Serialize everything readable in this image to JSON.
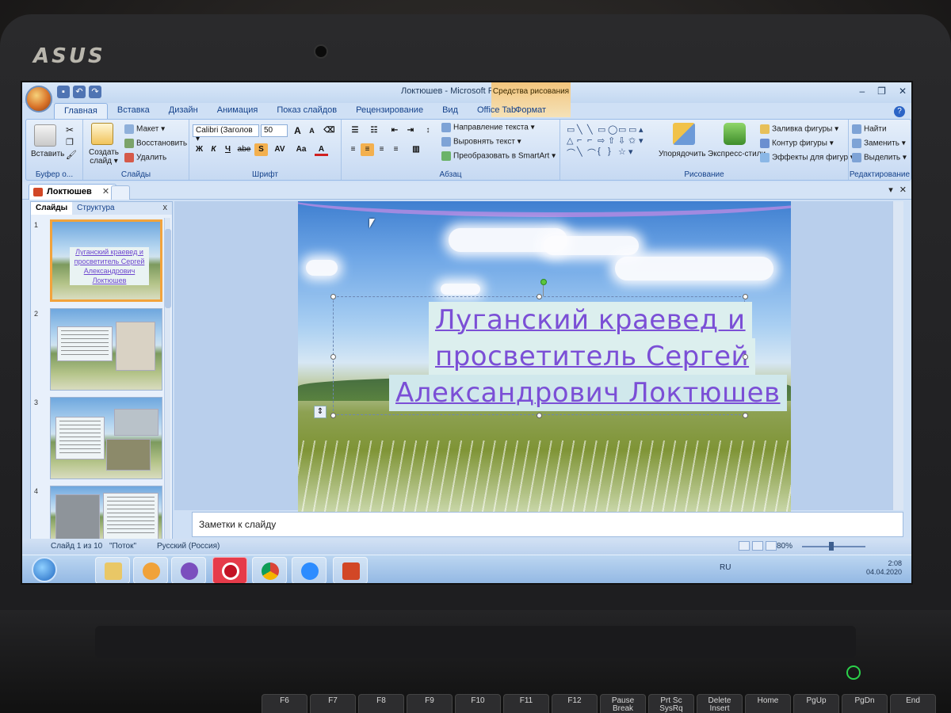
{
  "laptop": {
    "brand": "ASUS"
  },
  "window": {
    "title": "Локтюшев - Microsoft PowerPoint",
    "contextual_group": "Средства рисования",
    "controls": [
      "–",
      "❐",
      "✕"
    ]
  },
  "ribbon_tabs": [
    "Главная",
    "Вставка",
    "Дизайн",
    "Анимация",
    "Показ слайдов",
    "Рецензирование",
    "Вид",
    "Office Tab"
  ],
  "ribbon_tab_format": "Формат",
  "ribbon": {
    "clipboard": {
      "paste": "Вставить",
      "label": "Буфер о..."
    },
    "slides": {
      "new_slide": "Создать слайд ▾",
      "layout": "Макет ▾",
      "reset": "Восстановить",
      "delete": "Удалить",
      "label": "Слайды"
    },
    "font": {
      "font_name": "Calibri (Заголов ▾",
      "font_size": "50",
      "label": "Шрифт",
      "buttons": [
        "Ж",
        "К",
        "Ч",
        "abe",
        "S",
        "AV",
        "Aa",
        "A"
      ]
    },
    "paragraph": {
      "text_direction": "Направление текста ▾",
      "align_text": "Выровнять текст ▾",
      "convert_smartart": "Преобразовать в SmartArt ▾",
      "label": "Абзац"
    },
    "drawing": {
      "arrange": "Упорядочить",
      "quick_styles": "Экспресс-стили",
      "shape_fill": "Заливка фигуры ▾",
      "shape_outline": "Контур фигуры ▾",
      "shape_effects": "Эффекты для фигур ▾",
      "label": "Рисование"
    },
    "editing": {
      "find": "Найти",
      "replace": "Заменить ▾",
      "select": "Выделить ▾",
      "label": "Редактирование"
    }
  },
  "document_tab": {
    "name": "Локтюшев",
    "close": "✕"
  },
  "left_panel": {
    "tabs": [
      "Слайды",
      "Структура"
    ],
    "close": "x",
    "slide_numbers": [
      "1",
      "2",
      "3",
      "4"
    ],
    "thumb1_title": "Луганский краевед и просветитель Сергей Александрович Локтюшев"
  },
  "slide": {
    "title_lines": [
      "Луганский краевед и",
      "просветитель Сергей",
      "Александрович Локтюшев"
    ]
  },
  "notes_placeholder": "Заметки к слайду",
  "status_bar": {
    "slide_info": "Слайд 1 из 10",
    "theme": "\"Поток\"",
    "language": "Русский (Россия)",
    "zoom": "80%"
  },
  "taskbar": {
    "lang": "RU",
    "time": "2:08",
    "date": "04.04.2020"
  },
  "keyboard_keys": [
    "F6",
    "F7",
    "F8",
    "F9",
    "F10",
    "F11",
    "F12",
    "Pause Break",
    "Prt Sc SysRq",
    "Delete Insert",
    "Home",
    "PgUp",
    "PgDn",
    "End"
  ]
}
